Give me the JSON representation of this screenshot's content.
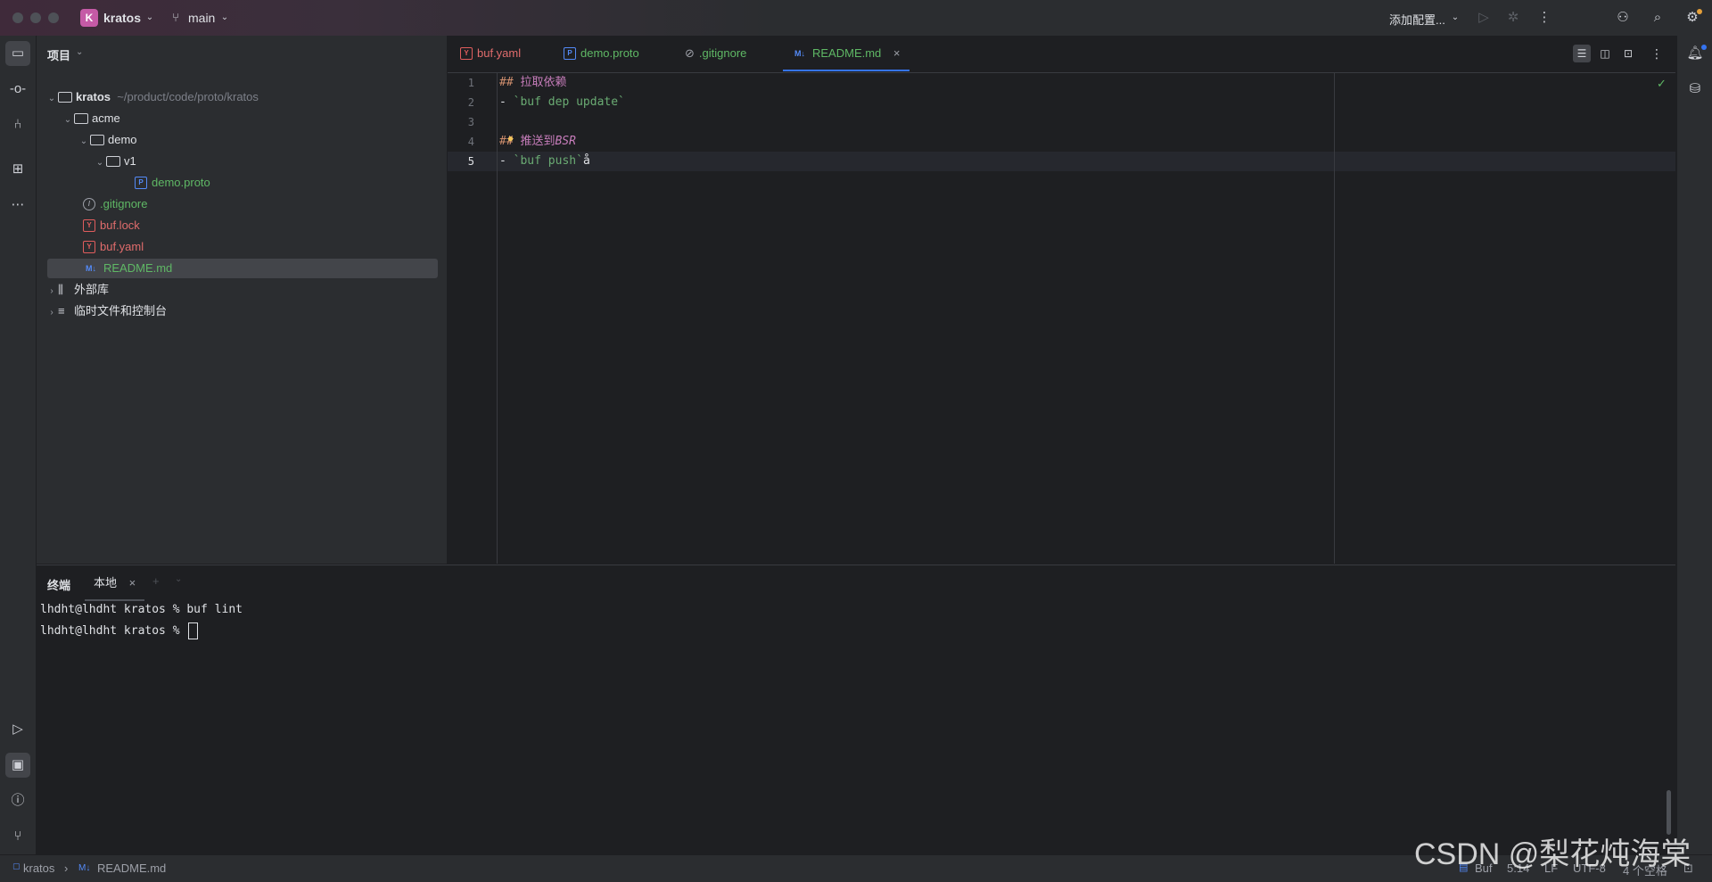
{
  "titlebar": {
    "project_initial": "K",
    "project_name": "kratos",
    "branch": "main",
    "run_config": "添加配置..."
  },
  "project_pane": {
    "title": "项目",
    "root": {
      "name": "kratos",
      "path": "~/product/code/proto/kratos"
    },
    "items": [
      {
        "label": "acme"
      },
      {
        "label": "demo"
      },
      {
        "label": "v1"
      },
      {
        "label": "demo.proto"
      },
      {
        "label": ".gitignore"
      },
      {
        "label": "buf.lock"
      },
      {
        "label": "buf.yaml"
      },
      {
        "label": "README.md"
      },
      {
        "label": "外部库"
      },
      {
        "label": "临时文件和控制台"
      }
    ]
  },
  "tabs": [
    {
      "icon": "Y",
      "label": "buf.yaml"
    },
    {
      "icon": "P",
      "label": "demo.proto"
    },
    {
      "icon": "⊘",
      "label": ".gitignore"
    },
    {
      "icon": "M↓",
      "label": "README.md"
    }
  ],
  "editor": {
    "line_numbers": [
      "1",
      "2",
      "3",
      "4",
      "5"
    ],
    "lines": [
      {
        "hash": "##",
        "text": " 拉取依赖"
      },
      {
        "prefix": "- ",
        "code": "`buf dep update`"
      },
      {
        "prefix": ""
      },
      {
        "hash": "##",
        "text": " 推送到",
        "italic": "BSR"
      },
      {
        "prefix": "- ",
        "code": "`buf push`",
        "tail": "å"
      }
    ]
  },
  "terminal": {
    "title": "终端",
    "tab_local": "本地",
    "lines": [
      "lhdht@lhdht kratos % buf lint",
      "lhdht@lhdht kratos % "
    ]
  },
  "statusbar": {
    "breadcrumb_root": "kratos",
    "breadcrumb_file": "README.md",
    "filetype": "Buf",
    "position": "5:14",
    "line_sep": "LF",
    "encoding": "UTF-8",
    "indent": "4 个空格"
  },
  "watermark": "CSDN @梨花炖海棠"
}
